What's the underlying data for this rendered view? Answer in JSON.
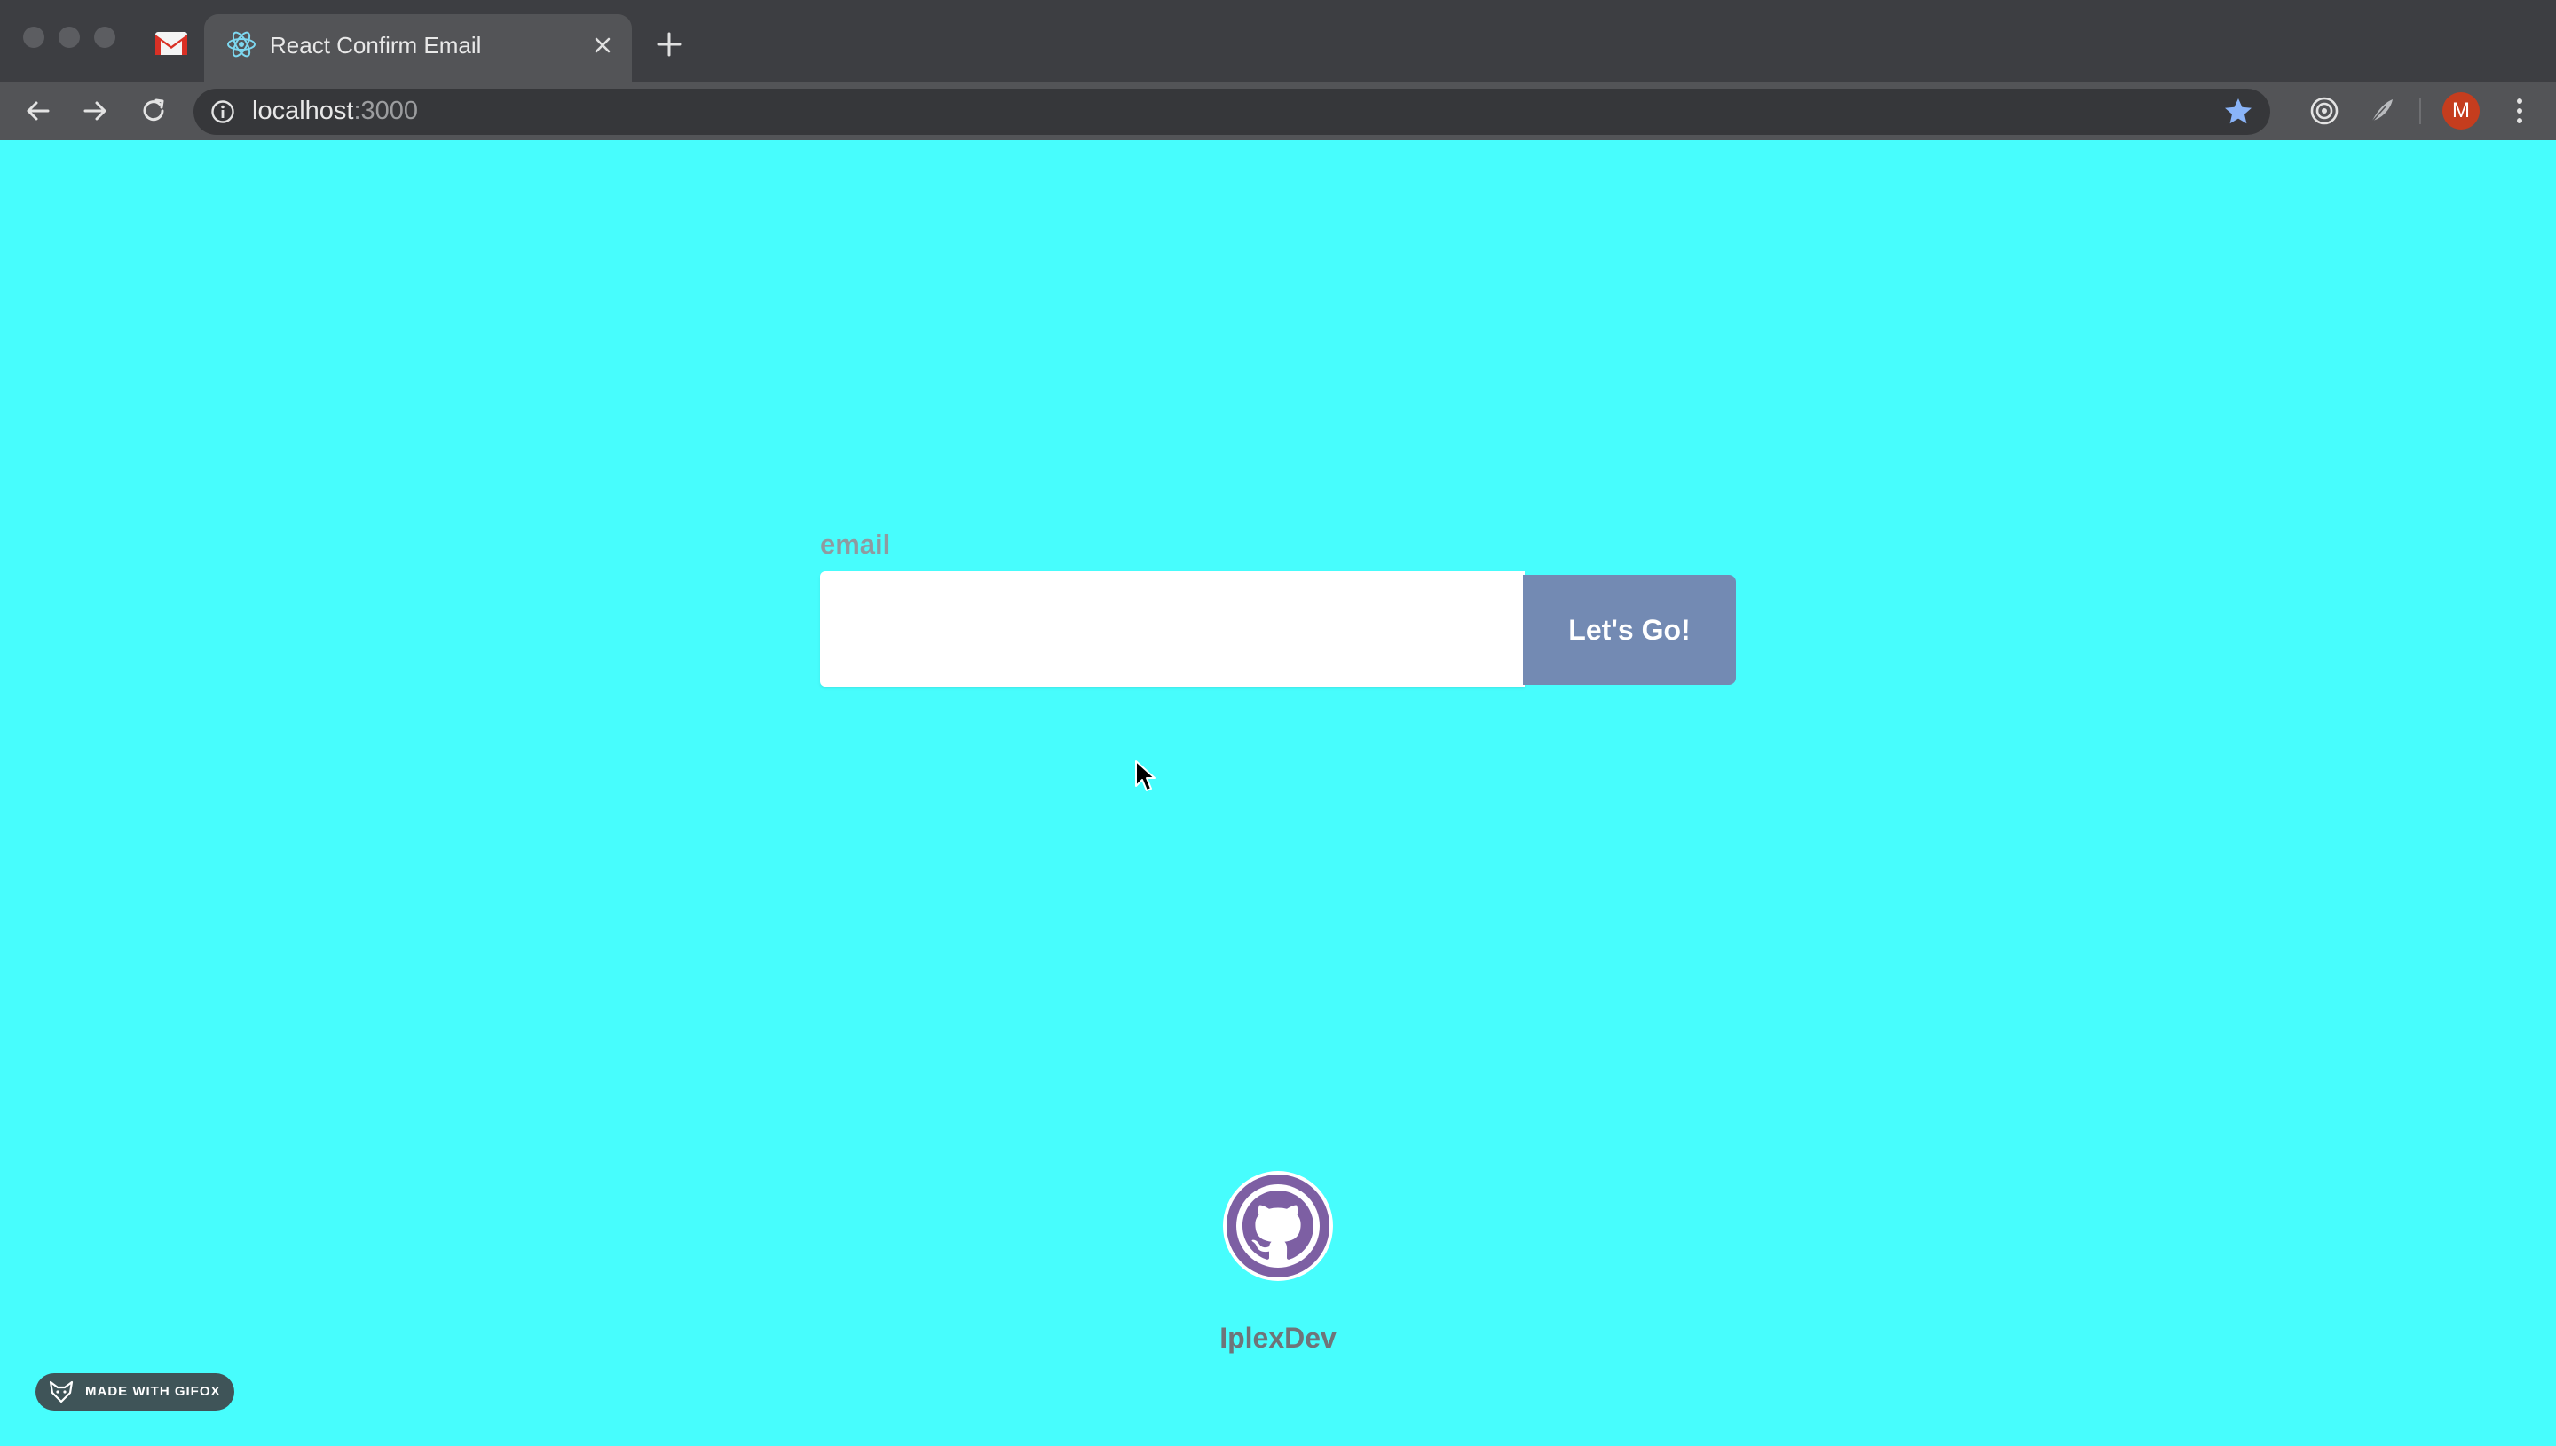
{
  "browser": {
    "tab_title": "React Confirm Email",
    "url_host": "localhost",
    "url_port": ":3000",
    "avatar_letter": "M",
    "colors": {
      "titlebar": "#3d3e42",
      "toolbar": "#535457",
      "avatar": "#c53d1e",
      "star": "#8ab4f8"
    },
    "icons": [
      "gmail-icon",
      "react-icon",
      "close-icon",
      "plus-icon",
      "back-arrow-icon",
      "forward-arrow-icon",
      "reload-icon",
      "info-icon",
      "star-icon",
      "target-icon",
      "feather-icon",
      "kebab-menu-icon"
    ]
  },
  "page": {
    "background": "#47fdfd",
    "email_label": "email",
    "email_value": "",
    "submit_label": "Let's Go!",
    "github_user": "IplexDev",
    "watermark": "MADE WITH GIFOX",
    "colors": {
      "button": "#738ab3",
      "github_circle": "#7d5fa3"
    }
  }
}
